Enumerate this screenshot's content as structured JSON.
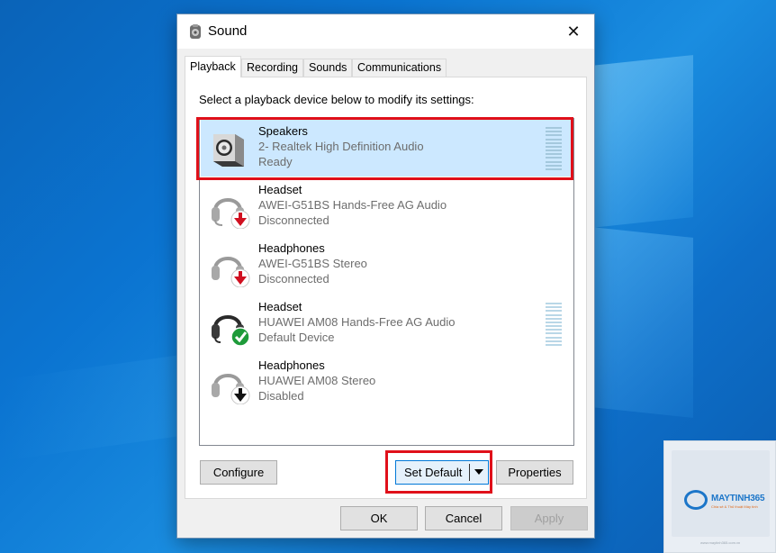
{
  "window": {
    "title": "Sound",
    "close_glyph": "✕"
  },
  "tabs": [
    {
      "label": "Playback"
    },
    {
      "label": "Recording"
    },
    {
      "label": "Sounds"
    },
    {
      "label": "Communications"
    }
  ],
  "instruction": "Select a playback device below to modify its settings:",
  "devices": [
    {
      "name": "Speakers",
      "description": "2- Realtek High Definition Audio",
      "status": "Ready",
      "icon": "speaker-icon",
      "badge": "none",
      "selected": true,
      "meter": true
    },
    {
      "name": "Headset",
      "description": "AWEI-G51BS Hands-Free AG Audio",
      "status": "Disconnected",
      "icon": "headset-icon",
      "badge": "red-down-arrow",
      "selected": false,
      "meter": false
    },
    {
      "name": "Headphones",
      "description": "AWEI-G51BS Stereo",
      "status": "Disconnected",
      "icon": "headphones-icon",
      "badge": "red-down-arrow",
      "selected": false,
      "meter": false
    },
    {
      "name": "Headset",
      "description": "HUAWEI AM08 Hands-Free AG Audio",
      "status": "Default Device",
      "icon": "headset-icon",
      "badge": "green-check",
      "selected": false,
      "meter": true
    },
    {
      "name": "Headphones",
      "description": "HUAWEI AM08 Stereo",
      "status": "Disabled",
      "icon": "headphones-icon",
      "badge": "black-down-arrow",
      "selected": false,
      "meter": false
    }
  ],
  "buttons": {
    "configure": "Configure",
    "set_default": "Set Default",
    "properties": "Properties",
    "ok": "OK",
    "cancel": "Cancel",
    "apply": "Apply"
  },
  "watermark": {
    "brand": "MAYTINH365",
    "tagline": "Chia sẻ & Thủ thuật Máy tính",
    "url": "www.maytinh365.com.vn"
  },
  "colors": {
    "highlight": "#e0101a",
    "selection": "#cce8ff",
    "accent": "#0078d7"
  }
}
